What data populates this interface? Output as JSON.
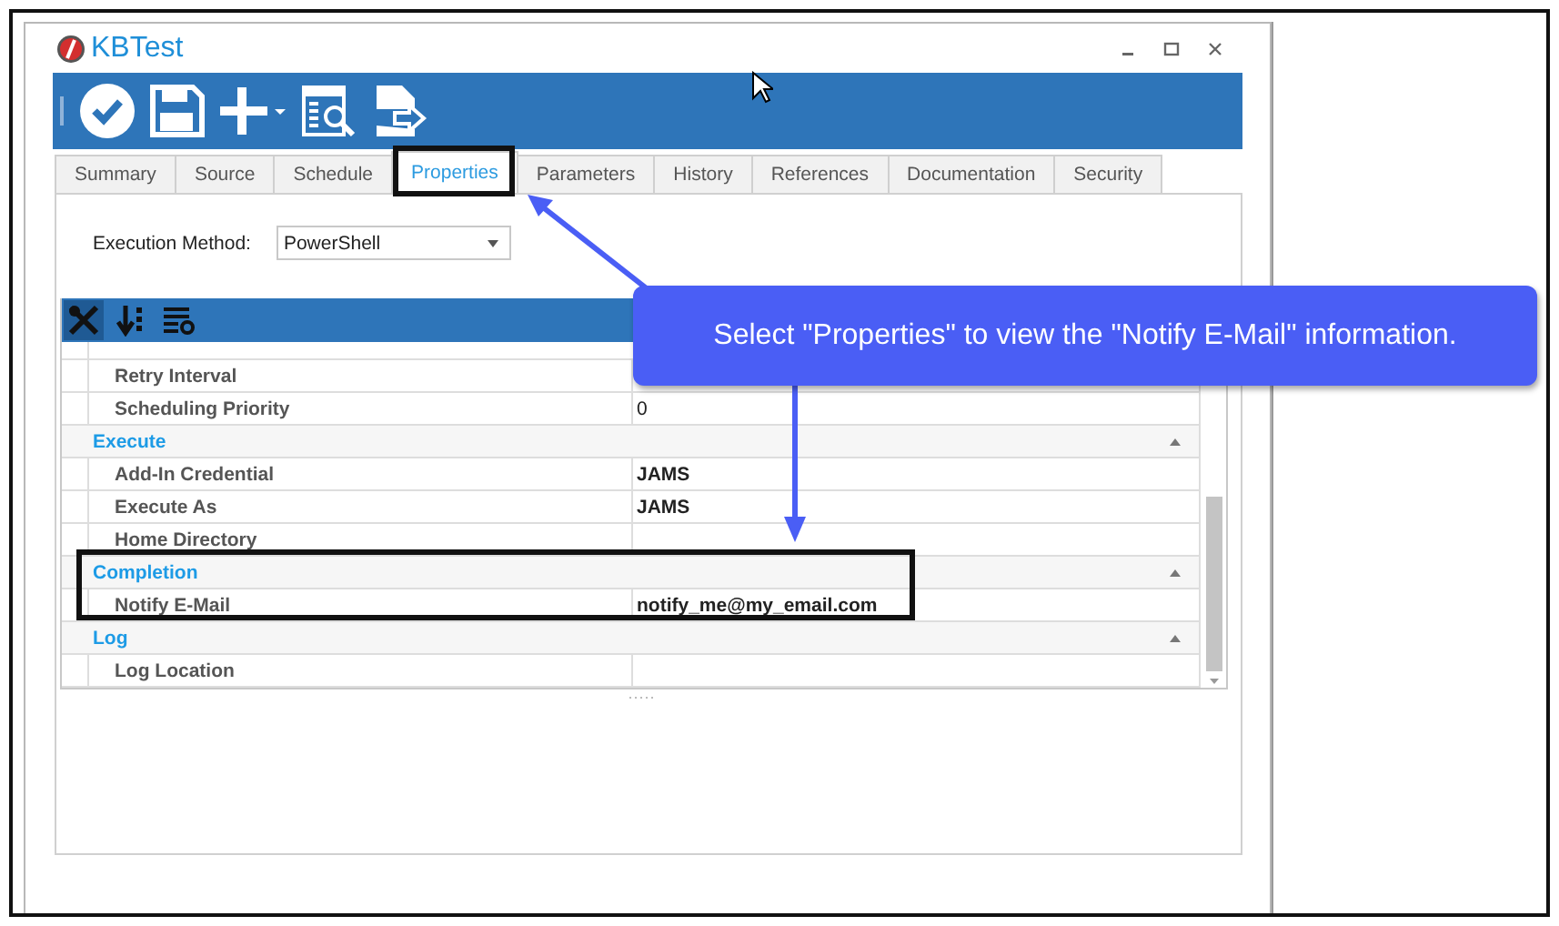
{
  "window": {
    "title": "KBTest"
  },
  "tabs": [
    {
      "label": "Summary",
      "selected": false
    },
    {
      "label": "Source",
      "selected": false
    },
    {
      "label": "Schedule",
      "selected": false
    },
    {
      "label": "Properties",
      "selected": true
    },
    {
      "label": "Parameters",
      "selected": false
    },
    {
      "label": "History",
      "selected": false
    },
    {
      "label": "References",
      "selected": false
    },
    {
      "label": "Documentation",
      "selected": false
    },
    {
      "label": "Security",
      "selected": false
    }
  ],
  "execution_method": {
    "label": "Execution Method:",
    "value": "PowerShell"
  },
  "property_grid": {
    "groups": [
      {
        "rows": [
          {
            "name": "Retry Interval"
          },
          {
            "name": "Scheduling Priority",
            "value": "0",
            "modified": false
          }
        ]
      },
      {
        "title": "Execute",
        "expanded": true,
        "rows": [
          {
            "name": "Add-In Credential",
            "value": "JAMS",
            "modified": true
          },
          {
            "name": "Execute As",
            "value": "JAMS",
            "modified": true
          },
          {
            "name": "Home Directory"
          }
        ]
      },
      {
        "title": "Completion",
        "expanded": true,
        "rows": [
          {
            "name": "Notify E-Mail",
            "value": "notify_me@my_email.com",
            "modified": true
          }
        ]
      },
      {
        "title": "Log",
        "expanded": true,
        "rows": [
          {
            "name": "Log Location"
          }
        ]
      }
    ]
  },
  "callout": {
    "text": "Select \"Properties\" to view the \"Notify E-Mail\" information."
  }
}
